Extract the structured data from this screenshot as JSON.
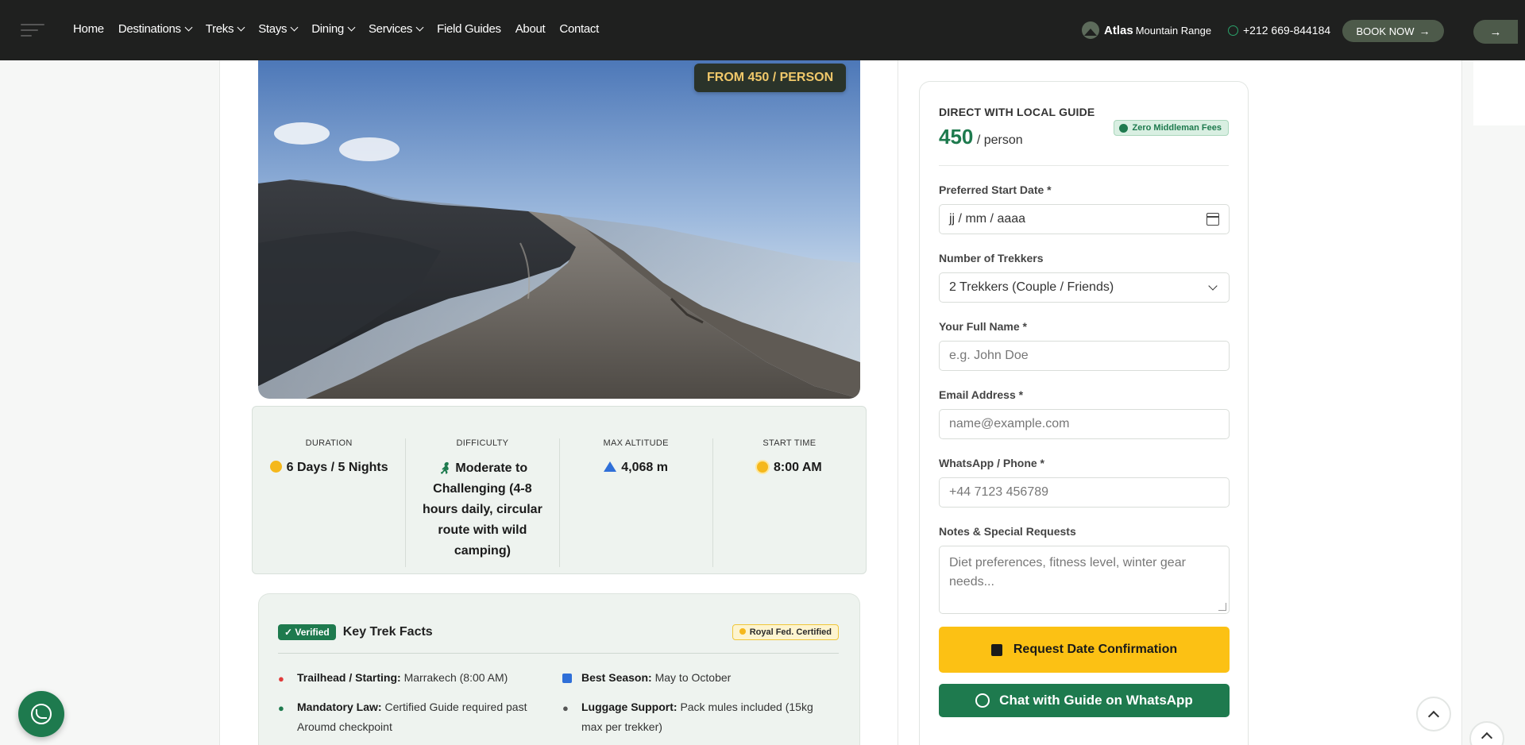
{
  "nav": {
    "items": [
      {
        "label": "Home",
        "dropdown": false
      },
      {
        "label": "Destinations",
        "dropdown": true
      },
      {
        "label": "Treks",
        "dropdown": true
      },
      {
        "label": "Stays",
        "dropdown": true
      },
      {
        "label": "Dining",
        "dropdown": true
      },
      {
        "label": "Services",
        "dropdown": true
      },
      {
        "label": "Field Guides",
        "dropdown": false
      },
      {
        "label": "About",
        "dropdown": false
      },
      {
        "label": "Contact",
        "dropdown": false
      }
    ],
    "brand_name": "Atlas",
    "brand_sub": "Mountain Range",
    "phone": "+212 669-844184",
    "book_label": "BOOK NOW",
    "side_tab_icon": "arrow-right-icon"
  },
  "hero": {
    "price_badge": "FROM 450 / PERSON"
  },
  "stats": [
    {
      "label": "DURATION",
      "value": "6 Days / 5 Nights",
      "icon": "clock-icon"
    },
    {
      "label": "DIFFICULTY",
      "value": "Moderate to Challenging (4-8 hours daily, circular route with wild camping)",
      "icon": "hiker-icon"
    },
    {
      "label": "MAX ALTITUDE",
      "value": "4,068 m",
      "icon": "mountain-icon"
    },
    {
      "label": "START TIME",
      "value": "8:00 AM",
      "icon": "sun-icon"
    }
  ],
  "facts": {
    "verified": "Verified",
    "title": "Key Trek Facts",
    "badge": "Royal Fed. Certified",
    "items": [
      {
        "key": "Trailhead / Starting:",
        "value": "Marrakech (8:00 AM)",
        "icon": "pin-icon"
      },
      {
        "key": "Best Season:",
        "value": "May to October",
        "icon": "calendar-icon"
      },
      {
        "key": "Mandatory Law:",
        "value": "Certified Guide required past Aroumd checkpoint",
        "icon": "user-check-icon"
      },
      {
        "key": "Luggage Support:",
        "value": "Pack mules included (15kg max per trekker)",
        "icon": "mule-icon"
      }
    ]
  },
  "booking": {
    "kicker": "DIRECT WITH LOCAL GUIDE",
    "price": "450",
    "per": "/ person",
    "zero_fee": "Zero Middleman Fees",
    "date_label": "Preferred Start Date *",
    "date_value": "jj / mm / aaaa",
    "trekkers_label": "Number of Trekkers",
    "trekkers_value": "2 Trekkers (Couple / Friends)",
    "name_label": "Your Full Name *",
    "name_placeholder": "e.g. John Doe",
    "email_label": "Email Address *",
    "email_placeholder": "name@example.com",
    "phone_label": "WhatsApp / Phone *",
    "phone_placeholder": "+44 7123 456789",
    "notes_label": "Notes & Special Requests",
    "notes_placeholder": "Diet preferences, fitness level, winter gear needs...",
    "confirm_label": "Request Date Confirmation",
    "whatsapp_label": "Chat with Guide on WhatsApp"
  },
  "colors": {
    "nav_bg": "#1f201f",
    "brand_green": "#1e7a4e",
    "accent_yellow": "#fcc114",
    "badge_gold": "#f0c86a"
  }
}
